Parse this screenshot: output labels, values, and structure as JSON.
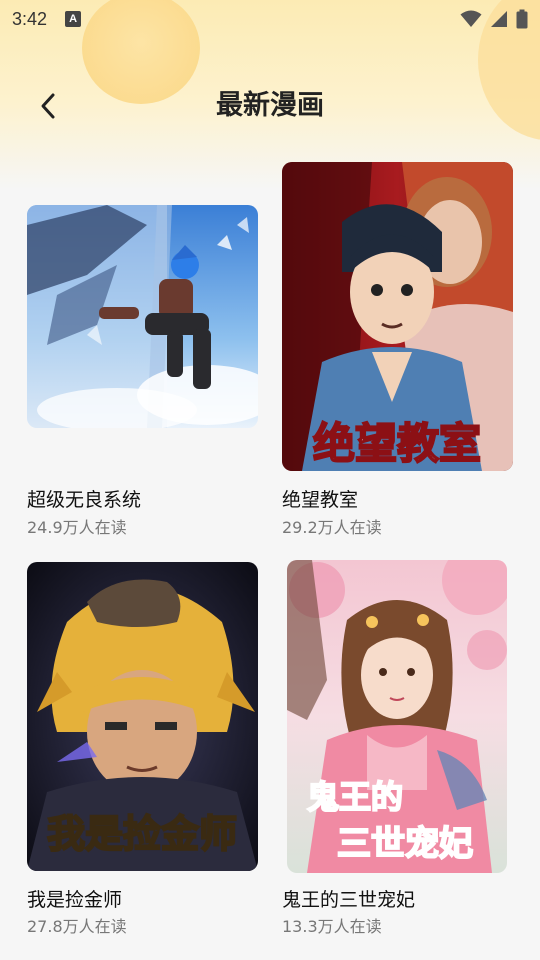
{
  "status_bar": {
    "time": "3:42",
    "notification_icon": "A",
    "icons": [
      "wifi-icon",
      "signal-icon",
      "battery-icon"
    ]
  },
  "header": {
    "title": "最新漫画",
    "back_icon": "chevron-left-icon"
  },
  "comics": [
    {
      "title": "超级无良系统",
      "readers": "24.9万人在读"
    },
    {
      "title": "绝望教室",
      "readers": "29.2万人在读",
      "cover_text": "绝望教室"
    },
    {
      "title": "我是捡金师",
      "readers": "27.8万人在读",
      "cover_text": "我是捡金师"
    },
    {
      "title": "鬼王的三世宠妃",
      "readers": "13.3万人在读",
      "cover_text_line1": "鬼王的",
      "cover_text_line2": "三世宠妃"
    }
  ],
  "colors": {
    "header_gradient_top": "#fcebb4",
    "background": "#f6f6f6",
    "title_text": "#222222",
    "secondary_text": "#777777"
  }
}
